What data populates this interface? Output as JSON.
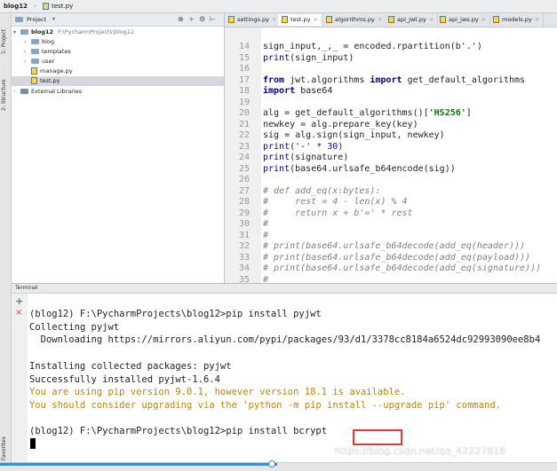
{
  "titlebar": {
    "project": "blog12",
    "file": "test.py"
  },
  "sidebar_tabs": {
    "project": "1: Project",
    "structure": "2: Structure",
    "favorites": "2: Favorites"
  },
  "project_panel": {
    "title": "Project",
    "root": "blog12",
    "root_path": "F:\\PycharmProjects\\blog12",
    "items": [
      {
        "label": "blog",
        "type": "folder"
      },
      {
        "label": "templates",
        "type": "folder"
      },
      {
        "label": "user",
        "type": "folder"
      },
      {
        "label": "manage.py",
        "type": "file"
      },
      {
        "label": "test.py",
        "type": "file"
      }
    ],
    "external": "External Libraries"
  },
  "editor_tabs": [
    "settings.py",
    "test.py",
    "algorithms.py",
    "api_jwt.py",
    "api_jws.py",
    "models.py"
  ],
  "code_lines": [
    {
      "n": "14",
      "segs": [
        {
          "t": "sign_input,_,_ = encoded.rpartition(b'.')"
        }
      ]
    },
    {
      "n": "15",
      "segs": [
        {
          "t": "print",
          "c": "bi"
        },
        {
          "t": "(sign_input)"
        }
      ]
    },
    {
      "n": "16",
      "segs": []
    },
    {
      "n": "17",
      "segs": [
        {
          "t": "from",
          "c": "kw"
        },
        {
          "t": " jwt.algorithms "
        },
        {
          "t": "import",
          "c": "kw"
        },
        {
          "t": " get_default_algorithms"
        }
      ]
    },
    {
      "n": "18",
      "segs": [
        {
          "t": "import",
          "c": "kw"
        },
        {
          "t": " base64"
        }
      ]
    },
    {
      "n": "19",
      "segs": []
    },
    {
      "n": "20",
      "segs": [
        {
          "t": "alg = get_default_algorithms()["
        },
        {
          "t": "'HS256'",
          "c": "st"
        },
        {
          "t": "]"
        }
      ]
    },
    {
      "n": "21",
      "segs": [
        {
          "t": "newkey = alg.prepare_key(key)"
        }
      ]
    },
    {
      "n": "22",
      "segs": [
        {
          "t": "sig = alg.sign(sign_input, newkey)"
        }
      ]
    },
    {
      "n": "23",
      "segs": [
        {
          "t": "print",
          "c": "bi"
        },
        {
          "t": "('-' * "
        },
        {
          "t": "30",
          "c": "nu"
        },
        {
          "t": ")"
        }
      ]
    },
    {
      "n": "24",
      "segs": [
        {
          "t": "print",
          "c": "bi"
        },
        {
          "t": "(signature)"
        }
      ]
    },
    {
      "n": "25",
      "segs": [
        {
          "t": "print",
          "c": "bi"
        },
        {
          "t": "(base64.urlsafe_b64encode(sig))"
        }
      ]
    },
    {
      "n": "26",
      "segs": []
    },
    {
      "n": "27",
      "segs": [
        {
          "t": "# def add_eq(x:bytes):",
          "c": "cm"
        }
      ]
    },
    {
      "n": "28",
      "segs": [
        {
          "t": "#     rest = 4 - len(x) % 4",
          "c": "cm"
        }
      ]
    },
    {
      "n": "29",
      "segs": [
        {
          "t": "#     return x + b'=' * rest",
          "c": "cm"
        }
      ]
    },
    {
      "n": "30",
      "segs": [
        {
          "t": "#",
          "c": "cm"
        }
      ]
    },
    {
      "n": "31",
      "segs": [
        {
          "t": "#",
          "c": "cm"
        }
      ]
    },
    {
      "n": "32",
      "segs": [
        {
          "t": "# print(base64.urlsafe_b64decode(add_eq(header)))",
          "c": "cm"
        }
      ]
    },
    {
      "n": "33",
      "segs": [
        {
          "t": "# print(base64.urlsafe_b64decode(add_eq(payload)))",
          "c": "cm"
        }
      ]
    },
    {
      "n": "34",
      "segs": [
        {
          "t": "# print(base64.urlsafe_b64decode(add_eq(signature)))",
          "c": "cm"
        }
      ]
    },
    {
      "n": "35",
      "segs": [
        {
          "t": "#",
          "c": "cm"
        }
      ]
    }
  ],
  "terminal": {
    "title": "Terminal",
    "lines": [
      {
        "t": "(blog12) F:\\PycharmProjects\\blog12>pip install pyjwt",
        "c": ""
      },
      {
        "t": "Collecting pyjwt",
        "c": ""
      },
      {
        "t": "  Downloading https://mirrors.aliyun.com/pypi/packages/93/d1/3378cc8184a6524dc92993090ee8b4",
        "c": ""
      },
      {
        "t": "",
        "c": ""
      },
      {
        "t": "Installing collected packages: pyjwt",
        "c": ""
      },
      {
        "t": "Successfully installed pyjwt-1.6.4",
        "c": ""
      },
      {
        "t": "You are using pip version 9.0.1, however version 18.1 is available.",
        "c": "warn"
      },
      {
        "t": "You should consider upgrading via the 'python -m pip install --upgrade pip' command.",
        "c": "warn"
      },
      {
        "t": "",
        "c": ""
      },
      {
        "t": "(blog12) F:\\PycharmProjects\\blog12>pip install bcrypt",
        "c": ""
      }
    ],
    "watermark": "https://blog.csdn.net/qq_42227818"
  },
  "colors": {
    "highlight_box": "#e53935",
    "progress": "#3d8bd4"
  }
}
